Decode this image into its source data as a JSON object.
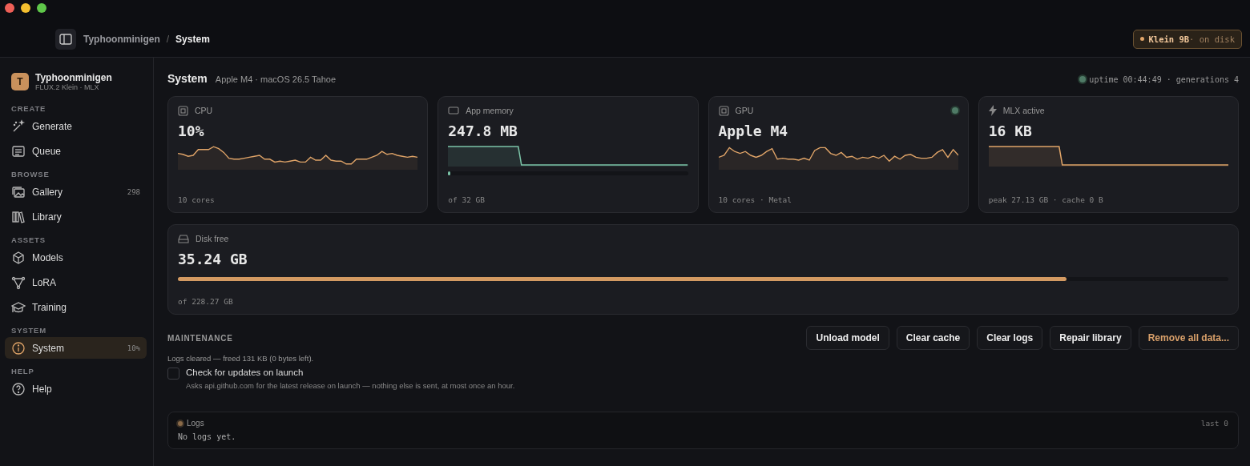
{
  "breadcrumb": {
    "parent": "Typhoonminigen",
    "separator": "/",
    "current": "System"
  },
  "model_badge": {
    "name": "Klein 9B",
    "status": "· on disk"
  },
  "brand": {
    "initial": "T",
    "name": "Typhoonminigen",
    "subtitle": "FLUX.2 Klein · MLX"
  },
  "sidebar": [
    {
      "heading": "CREATE",
      "items": [
        {
          "label": "Generate",
          "selected": false
        },
        {
          "label": "Queue",
          "selected": false
        }
      ]
    },
    {
      "heading": "BROWSE",
      "items": [
        {
          "label": "Gallery",
          "count": "298",
          "selected": false
        },
        {
          "label": "Library",
          "selected": false
        }
      ]
    },
    {
      "heading": "ASSETS",
      "items": [
        {
          "label": "Models",
          "selected": false
        },
        {
          "label": "LoRA",
          "selected": false
        },
        {
          "label": "Training",
          "selected": false
        }
      ]
    },
    {
      "heading": "SYSTEM",
      "items": [
        {
          "label": "System",
          "count": "10%",
          "selected": true
        }
      ]
    },
    {
      "heading": "HELP",
      "items": [
        {
          "label": "Help",
          "selected": false
        }
      ]
    }
  ],
  "page": {
    "title": "System",
    "subtitle": "Apple M4 · macOS 26.5 Tahoe",
    "status": "uptime 00:44:49 · generations 4"
  },
  "cards": [
    {
      "kind": "cpu",
      "label": "CPU",
      "value": "10%",
      "footer": "10 cores"
    },
    {
      "kind": "memory",
      "label": "App memory",
      "value": "247.8 MB",
      "footer": "of 32 GB",
      "level": 0.01
    },
    {
      "kind": "gpu",
      "label": "GPU",
      "value": "Apple M4",
      "footer": "10 cores · Metal"
    },
    {
      "kind": "mlx",
      "label": "MLX active",
      "value": "16 KB",
      "footer": "peak 27.13 GB · cache 0 B"
    }
  ],
  "disk": {
    "label": "Disk free",
    "value": "35.24 GB",
    "level": 0.846,
    "footer": "of 228.27 GB"
  },
  "maintenance": {
    "heading": "MAINTENANCE",
    "message": "Logs cleared — freed 131 KB (0 bytes left).",
    "buttons": [
      {
        "label": "Unload model",
        "kind": "normal"
      },
      {
        "label": "Clear cache",
        "kind": "normal"
      },
      {
        "label": "Clear logs",
        "kind": "normal"
      },
      {
        "label": "Repair library",
        "kind": "normal"
      },
      {
        "label": "Remove all data...",
        "kind": "danger"
      }
    ],
    "update_check": {
      "label": "Check for updates on launch",
      "description": "Asks api.github.com for the latest release on launch — nothing else is sent, at most once an hour.",
      "checked": false
    }
  },
  "logs": {
    "title": "Logs",
    "meta": "last 0",
    "empty": "No logs yet."
  }
}
